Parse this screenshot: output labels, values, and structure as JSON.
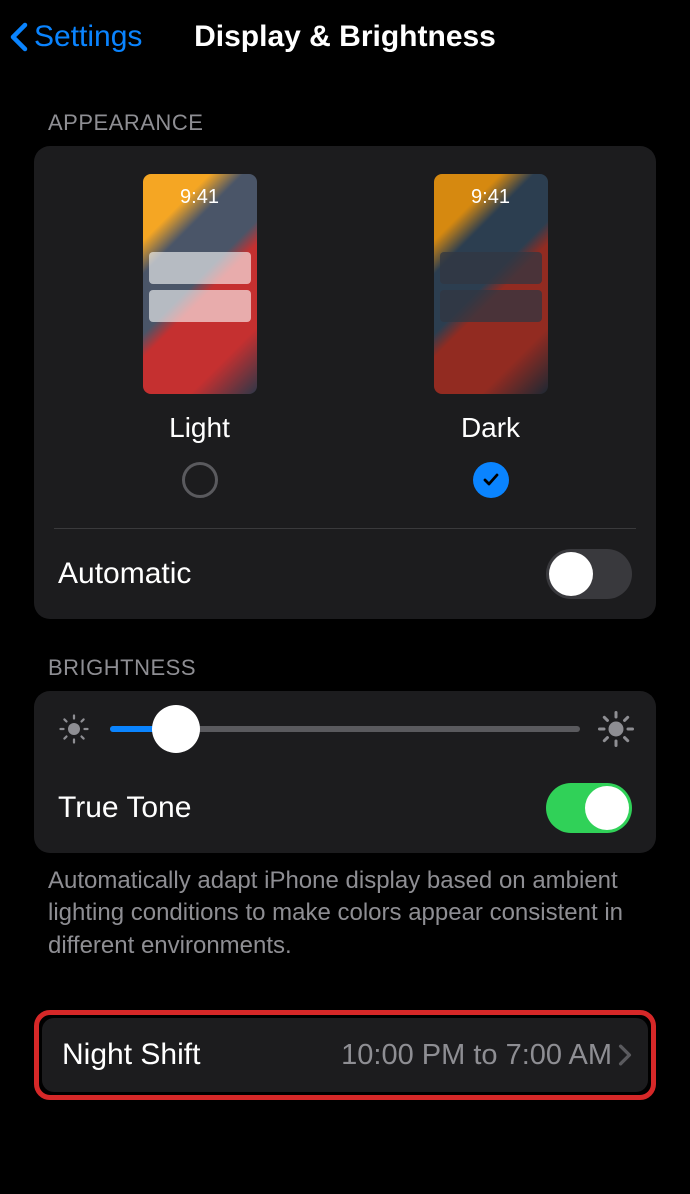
{
  "header": {
    "back_label": "Settings",
    "title": "Display & Brightness"
  },
  "appearance": {
    "section_label": "APPEARANCE",
    "preview_time": "9:41",
    "light_label": "Light",
    "dark_label": "Dark",
    "automatic_label": "Automatic"
  },
  "brightness": {
    "section_label": "BRIGHTNESS",
    "true_tone_label": "True Tone",
    "footer_text": "Automatically adapt iPhone display based on ambient lighting conditions to make colors appear consistent in different environments."
  },
  "night_shift": {
    "label": "Night Shift",
    "value": "10:00 PM to 7:00 AM"
  }
}
